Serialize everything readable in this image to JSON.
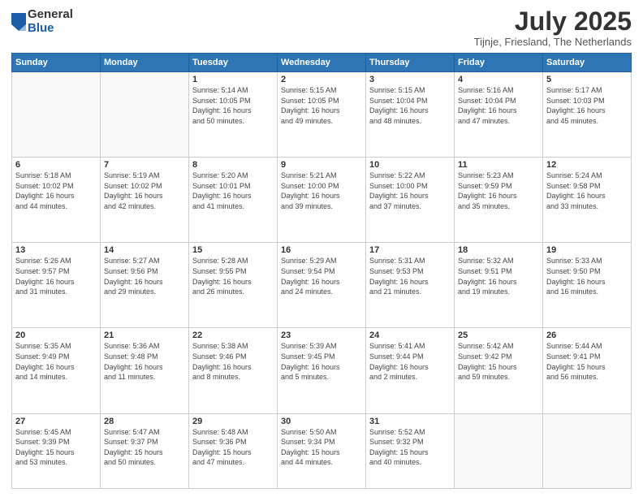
{
  "logo": {
    "general": "General",
    "blue": "Blue"
  },
  "title": "July 2025",
  "location": "Tijnje, Friesland, The Netherlands",
  "days_of_week": [
    "Sunday",
    "Monday",
    "Tuesday",
    "Wednesday",
    "Thursday",
    "Friday",
    "Saturday"
  ],
  "weeks": [
    [
      {
        "day": "",
        "info": ""
      },
      {
        "day": "",
        "info": ""
      },
      {
        "day": "1",
        "info": "Sunrise: 5:14 AM\nSunset: 10:05 PM\nDaylight: 16 hours\nand 50 minutes."
      },
      {
        "day": "2",
        "info": "Sunrise: 5:15 AM\nSunset: 10:05 PM\nDaylight: 16 hours\nand 49 minutes."
      },
      {
        "day": "3",
        "info": "Sunrise: 5:15 AM\nSunset: 10:04 PM\nDaylight: 16 hours\nand 48 minutes."
      },
      {
        "day": "4",
        "info": "Sunrise: 5:16 AM\nSunset: 10:04 PM\nDaylight: 16 hours\nand 47 minutes."
      },
      {
        "day": "5",
        "info": "Sunrise: 5:17 AM\nSunset: 10:03 PM\nDaylight: 16 hours\nand 45 minutes."
      }
    ],
    [
      {
        "day": "6",
        "info": "Sunrise: 5:18 AM\nSunset: 10:02 PM\nDaylight: 16 hours\nand 44 minutes."
      },
      {
        "day": "7",
        "info": "Sunrise: 5:19 AM\nSunset: 10:02 PM\nDaylight: 16 hours\nand 42 minutes."
      },
      {
        "day": "8",
        "info": "Sunrise: 5:20 AM\nSunset: 10:01 PM\nDaylight: 16 hours\nand 41 minutes."
      },
      {
        "day": "9",
        "info": "Sunrise: 5:21 AM\nSunset: 10:00 PM\nDaylight: 16 hours\nand 39 minutes."
      },
      {
        "day": "10",
        "info": "Sunrise: 5:22 AM\nSunset: 10:00 PM\nDaylight: 16 hours\nand 37 minutes."
      },
      {
        "day": "11",
        "info": "Sunrise: 5:23 AM\nSunset: 9:59 PM\nDaylight: 16 hours\nand 35 minutes."
      },
      {
        "day": "12",
        "info": "Sunrise: 5:24 AM\nSunset: 9:58 PM\nDaylight: 16 hours\nand 33 minutes."
      }
    ],
    [
      {
        "day": "13",
        "info": "Sunrise: 5:26 AM\nSunset: 9:57 PM\nDaylight: 16 hours\nand 31 minutes."
      },
      {
        "day": "14",
        "info": "Sunrise: 5:27 AM\nSunset: 9:56 PM\nDaylight: 16 hours\nand 29 minutes."
      },
      {
        "day": "15",
        "info": "Sunrise: 5:28 AM\nSunset: 9:55 PM\nDaylight: 16 hours\nand 26 minutes."
      },
      {
        "day": "16",
        "info": "Sunrise: 5:29 AM\nSunset: 9:54 PM\nDaylight: 16 hours\nand 24 minutes."
      },
      {
        "day": "17",
        "info": "Sunrise: 5:31 AM\nSunset: 9:53 PM\nDaylight: 16 hours\nand 21 minutes."
      },
      {
        "day": "18",
        "info": "Sunrise: 5:32 AM\nSunset: 9:51 PM\nDaylight: 16 hours\nand 19 minutes."
      },
      {
        "day": "19",
        "info": "Sunrise: 5:33 AM\nSunset: 9:50 PM\nDaylight: 16 hours\nand 16 minutes."
      }
    ],
    [
      {
        "day": "20",
        "info": "Sunrise: 5:35 AM\nSunset: 9:49 PM\nDaylight: 16 hours\nand 14 minutes."
      },
      {
        "day": "21",
        "info": "Sunrise: 5:36 AM\nSunset: 9:48 PM\nDaylight: 16 hours\nand 11 minutes."
      },
      {
        "day": "22",
        "info": "Sunrise: 5:38 AM\nSunset: 9:46 PM\nDaylight: 16 hours\nand 8 minutes."
      },
      {
        "day": "23",
        "info": "Sunrise: 5:39 AM\nSunset: 9:45 PM\nDaylight: 16 hours\nand 5 minutes."
      },
      {
        "day": "24",
        "info": "Sunrise: 5:41 AM\nSunset: 9:44 PM\nDaylight: 16 hours\nand 2 minutes."
      },
      {
        "day": "25",
        "info": "Sunrise: 5:42 AM\nSunset: 9:42 PM\nDaylight: 15 hours\nand 59 minutes."
      },
      {
        "day": "26",
        "info": "Sunrise: 5:44 AM\nSunset: 9:41 PM\nDaylight: 15 hours\nand 56 minutes."
      }
    ],
    [
      {
        "day": "27",
        "info": "Sunrise: 5:45 AM\nSunset: 9:39 PM\nDaylight: 15 hours\nand 53 minutes."
      },
      {
        "day": "28",
        "info": "Sunrise: 5:47 AM\nSunset: 9:37 PM\nDaylight: 15 hours\nand 50 minutes."
      },
      {
        "day": "29",
        "info": "Sunrise: 5:48 AM\nSunset: 9:36 PM\nDaylight: 15 hours\nand 47 minutes."
      },
      {
        "day": "30",
        "info": "Sunrise: 5:50 AM\nSunset: 9:34 PM\nDaylight: 15 hours\nand 44 minutes."
      },
      {
        "day": "31",
        "info": "Sunrise: 5:52 AM\nSunset: 9:32 PM\nDaylight: 15 hours\nand 40 minutes."
      },
      {
        "day": "",
        "info": ""
      },
      {
        "day": "",
        "info": ""
      }
    ]
  ]
}
